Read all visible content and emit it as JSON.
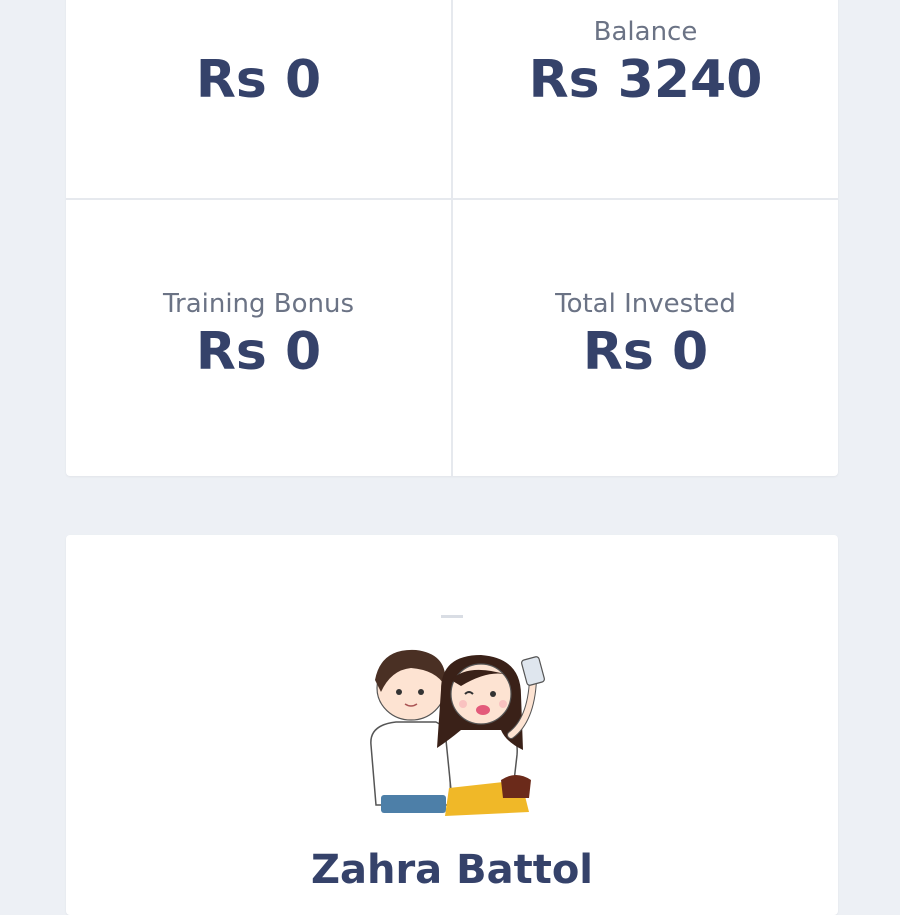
{
  "stats": [
    {
      "label": "",
      "value": "Rs 0"
    },
    {
      "label": "Balance",
      "value": "Rs 3240"
    },
    {
      "label": "Training Bonus",
      "value": "Rs 0"
    },
    {
      "label": "Total Invested",
      "value": "Rs 0"
    }
  ],
  "profile": {
    "name": "Zahra Battol",
    "avatar_icon": "couple-selfie-cartoon"
  },
  "colors": {
    "background": "#edf0f5",
    "card": "#ffffff",
    "value_text": "#35426a",
    "label_text": "#6b7385"
  }
}
